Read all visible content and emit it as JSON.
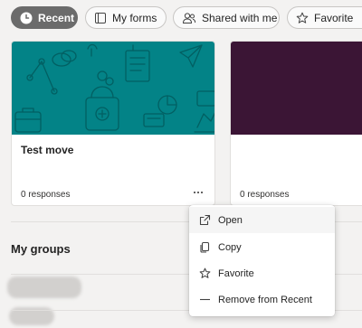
{
  "filters": {
    "recent": "Recent",
    "my_forms": "My forms",
    "shared_with_me": "Shared with me",
    "favorites": "Favorite"
  },
  "cards": [
    {
      "title": "Test move",
      "responses": "0 responses",
      "banner_color": "#038387"
    },
    {
      "title": "",
      "responses": "0 responses",
      "banner_color": "#3b1535"
    }
  ],
  "groups": {
    "heading": "My groups"
  },
  "context_menu": {
    "items": [
      {
        "label": "Open",
        "icon": "open-icon"
      },
      {
        "label": "Copy",
        "icon": "copy-icon"
      },
      {
        "label": "Favorite",
        "icon": "star-icon"
      },
      {
        "label": "Remove from Recent",
        "icon": "remove-icon"
      }
    ]
  }
}
